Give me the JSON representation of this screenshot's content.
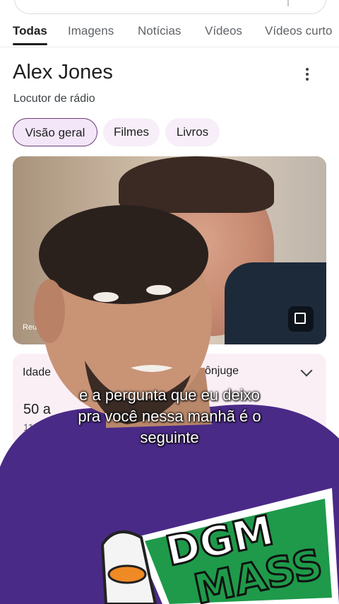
{
  "tabs": [
    "Todas",
    "Imagens",
    "Notícias",
    "Vídeos",
    "Vídeos curto"
  ],
  "entity": {
    "title": "Alex Jones",
    "subtitle": "Locutor de rádio"
  },
  "chips": [
    "Visão geral",
    "Filmes",
    "Livros"
  ],
  "hero_image": {
    "credit": "Reut"
  },
  "info": {
    "age_label": "Idade",
    "age_value": "50 a",
    "age_date": "11 de",
    "spouse_label": "ônjuge"
  },
  "caption": {
    "line1": "e a pergunta que eu deixo",
    "line2": "pra você nessa manhã é o",
    "line3": "seguinte"
  },
  "shirt_text": [
    "DGM",
    "MASS"
  ],
  "colors": {
    "accent_chip": "#f3e6f8",
    "chip_border": "#6b3a7a",
    "shirt": "#4a2a87",
    "shirt_print_green": "#1e9a4a"
  }
}
